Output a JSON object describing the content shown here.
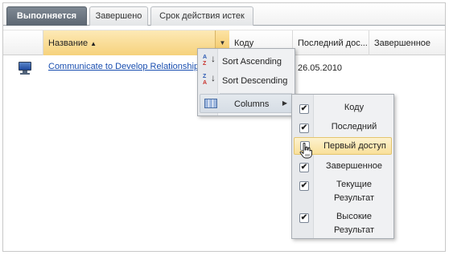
{
  "tabs": [
    {
      "label": "Выполняется",
      "active": true
    },
    {
      "label": "Завершено",
      "active": false
    },
    {
      "label": "Срок действия истек",
      "active": false
    }
  ],
  "grid": {
    "columns": {
      "name": "Название",
      "code": "Коду",
      "last_access": "Последний дос...",
      "completed": "Завершенное"
    },
    "sort_indicator": "▲",
    "menu_trigger": "▼",
    "rows": [
      {
        "icon": "computer-monitor-icon",
        "name": "Communicate to Develop Relationships",
        "date": "26.05.2010"
      }
    ]
  },
  "context_menu": {
    "sort_ascending": "Sort Ascending",
    "sort_descending": "Sort Descending",
    "columns": "Columns",
    "submenu_arrow": "▶",
    "icon_az_top": "A",
    "icon_az_bottom": "Z",
    "icon_za_top": "Z",
    "icon_za_bottom": "A",
    "icon_arrow": "↓"
  },
  "columns_submenu": {
    "items": [
      {
        "label": "Коду",
        "checked": true
      },
      {
        "label": "Последний доступ",
        "checked": true
      },
      {
        "label": "Первый доступ",
        "checked": false
      },
      {
        "label": "Завершенное",
        "checked": true
      },
      {
        "label_line1": "Текущие",
        "label_line2": "Результат",
        "checked": true
      },
      {
        "label_line1": "Высокие",
        "label_line2": "Результат",
        "checked": true
      }
    ],
    "check_mark": "✔"
  },
  "colors": {
    "active_tab": "#6b7580",
    "header_highlight": "#f6d27c",
    "link": "#1a4fb0",
    "hover_item": "#f9e09a"
  }
}
